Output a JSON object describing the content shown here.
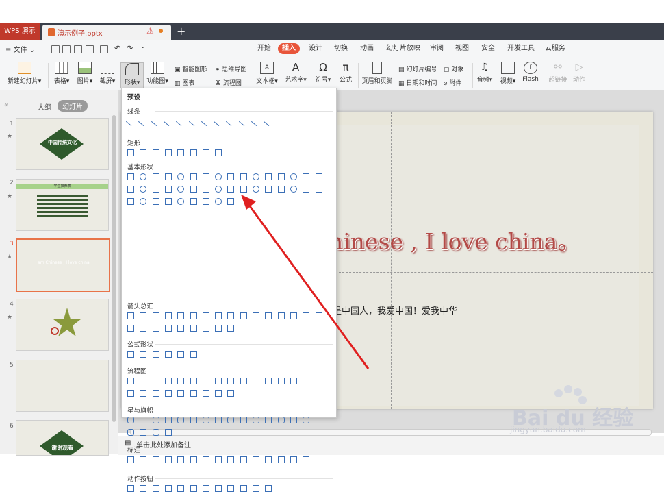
{
  "titlebar": {
    "app_label": "WPS 演示",
    "doc_name": "演示例子.pptx",
    "new_tab": "+"
  },
  "menu": {
    "file": "≡ 文件 ⌄",
    "tabs": [
      "开始",
      "插入",
      "设计",
      "切换",
      "动画",
      "幻灯片放映",
      "审阅",
      "视图",
      "安全",
      "开发工具",
      "云服务"
    ],
    "active_tab": "插入"
  },
  "ribbon": {
    "new_slide": "新建幻灯片",
    "table": "表格",
    "picture": "图片",
    "screenshot": "截屏",
    "shape": "形状",
    "function_chart": "功能图",
    "smart_graphic": "智能图形",
    "mind_map": "思维导图",
    "chart": "图表",
    "flowchart": "流程图",
    "textbox": "文本框",
    "art_text": "艺术字",
    "symbol": "符号",
    "formula": "公式",
    "header_footer": "页眉和页脚",
    "slide_number": "幻灯片编号",
    "date_time": "日期和时间",
    "object": "对象",
    "attachment": "附件",
    "audio": "音频",
    "video": "视频",
    "flash": "Flash",
    "hyperlink": "超链接",
    "action": "动作"
  },
  "panel": {
    "outline_tab": "大纲",
    "slides_tab": "幻灯片"
  },
  "thumbnails": [
    {
      "num": "1",
      "title": "中国传统文化"
    },
    {
      "num": "2",
      "title": "学生推荐表"
    },
    {
      "num": "3",
      "title": "I am Chinese , I love china."
    },
    {
      "num": "4",
      "title": ""
    },
    {
      "num": "5",
      "title": ""
    },
    {
      "num": "6",
      "title": "谢谢观看"
    }
  ],
  "dropdown": {
    "preset": "预设",
    "sections": [
      "线条",
      "矩形",
      "基本形状",
      "箭头总汇",
      "公式形状",
      "流程图",
      "星与旗帜",
      "标注",
      "动作按钮"
    ]
  },
  "slide": {
    "main_text": "hinese , I love china。",
    "sub_text": "是中国人，我爱中国！爱我中华"
  },
  "notes": {
    "placeholder": "单击此处添加备注"
  },
  "watermark": {
    "brand": "Bai du 经验",
    "url": "jingyan.baidu.com"
  }
}
